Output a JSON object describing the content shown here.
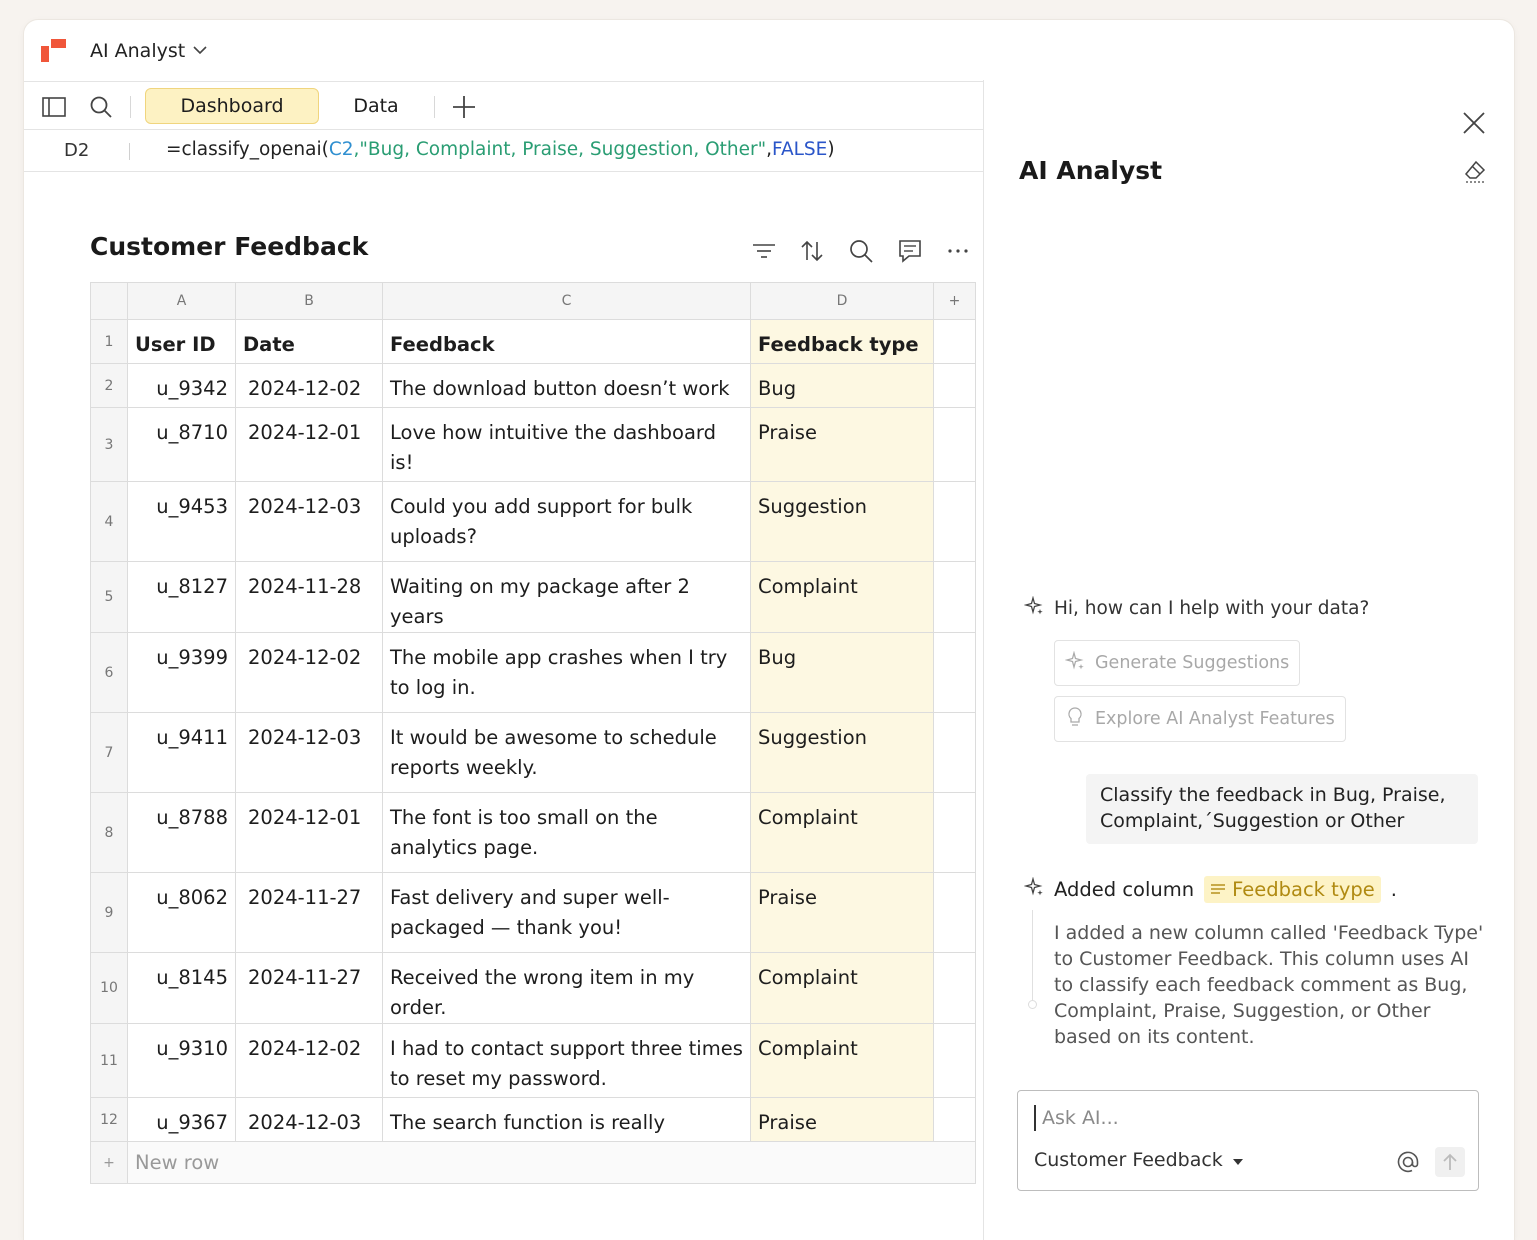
{
  "app": {
    "title": "AI Analyst"
  },
  "tabs": [
    {
      "label": "Dashboard"
    },
    {
      "label": "Data"
    }
  ],
  "formula": {
    "cell_ref": "D2",
    "prefix": "=classify_openai(",
    "ref": "C2",
    "comma1": ",",
    "string": "\"Bug, Complaint, Praise, Suggestion, Other\"",
    "comma2": ",",
    "bool": "FALSE",
    "suffix": ")"
  },
  "sheet": {
    "title": "Customer Feedback",
    "column_letters": [
      "A",
      "B",
      "C",
      "D",
      "+"
    ],
    "headers": {
      "row": "1",
      "user_id": "User ID",
      "date": "Date",
      "feedback": "Feedback",
      "type": "Feedback type"
    },
    "rows": [
      {
        "n": "2",
        "user_id": "u_9342",
        "date": "2024-12-02",
        "feedback": "The download button doesn’t work",
        "type": "Bug"
      },
      {
        "n": "3",
        "user_id": "u_8710",
        "date": "2024-12-01",
        "feedback": "Love how intuitive the dashboard is!",
        "type": "Praise"
      },
      {
        "n": "4",
        "user_id": "u_9453",
        "date": "2024-12-03",
        "feedback": "Could you add support for bulk uploads?",
        "type": "Suggestion"
      },
      {
        "n": "5",
        "user_id": "u_8127",
        "date": "2024-11-28",
        "feedback": "Waiting on my package after 2 years",
        "type": "Complaint"
      },
      {
        "n": "6",
        "user_id": "u_9399",
        "date": "2024-12-02",
        "feedback": "The mobile app crashes when I try to log in.",
        "type": "Bug"
      },
      {
        "n": "7",
        "user_id": "u_9411",
        "date": "2024-12-03",
        "feedback": "It would be awesome to schedule reports weekly.",
        "type": "Suggestion"
      },
      {
        "n": "8",
        "user_id": "u_8788",
        "date": "2024-12-01",
        "feedback": "The font is too small on the analytics page.",
        "type": "Complaint"
      },
      {
        "n": "9",
        "user_id": "u_8062",
        "date": "2024-11-27",
        "feedback": "Fast delivery and super well-packaged — thank you!",
        "type": "Praise"
      },
      {
        "n": "10",
        "user_id": "u_8145",
        "date": "2024-11-27",
        "feedback": "Received the wrong item in my order.",
        "type": "Complaint"
      },
      {
        "n": "11",
        "user_id": "u_9310",
        "date": "2024-12-02",
        "feedback": "I had to contact support three times to reset my password.",
        "type": "Complaint"
      },
      {
        "n": "12",
        "user_id": "u_9367",
        "date": "2024-12-03",
        "feedback": "The search function is really",
        "type": "Praise"
      }
    ],
    "new_row": {
      "plus": "+",
      "label": "New row"
    }
  },
  "panel": {
    "title": "AI Analyst",
    "greeting": "Hi, how can I help with your data?",
    "suggestions": [
      "Generate Suggestions",
      "Explore AI Analyst Features"
    ],
    "user_message": "Classify the feedback in Bug, Praise, Complaint,´Suggestion or Other",
    "added_prefix": "Added column",
    "added_chip": "Feedback type",
    "added_suffix": ".",
    "reply": "I added a new column called 'Feedback Type' to Customer Feedback. This column uses AI to classify each feedback comment as Bug, Complaint, Praise, Suggestion, or Other based on its content.",
    "ask": {
      "placeholder": "Ask AI...",
      "source": "Customer Feedback"
    }
  },
  "colors": {
    "accent": "#f0563a",
    "tab_active": "#fdf2c3",
    "highlight_column": "#fdf8e2",
    "chip": "#fdf3c6",
    "chip_text": "#b08a12"
  },
  "icons": [
    "app-logo",
    "chevron-down-icon",
    "sidebar-toggle-icon",
    "search-icon",
    "plus-icon",
    "filter-icon",
    "sort-icon",
    "comment-icon",
    "more-icon",
    "close-icon",
    "eraser-icon",
    "sparkle-icon",
    "lightbulb-icon",
    "lines-icon",
    "at-icon",
    "send-icon",
    "caret-down-icon"
  ]
}
